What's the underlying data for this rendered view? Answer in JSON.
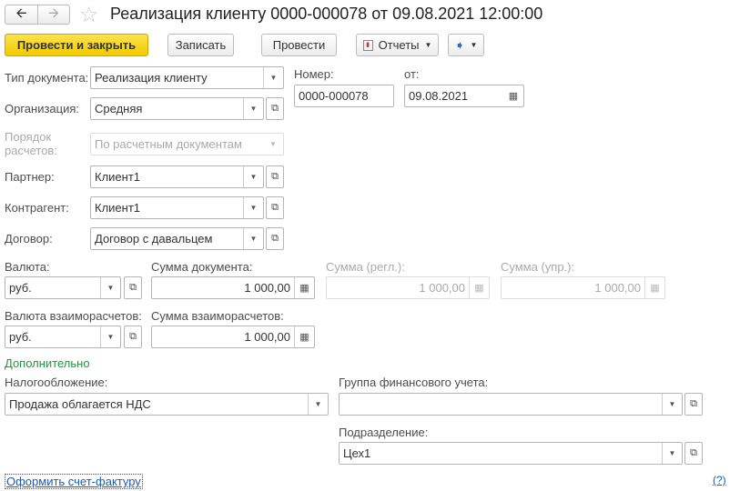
{
  "title": "Реализация клиенту 0000-000078 от 09.08.2021 12:00:00",
  "toolbar": {
    "post_close": "Провести и закрыть",
    "save": "Записать",
    "post": "Провести",
    "reports": "Отчеты"
  },
  "fields": {
    "doc_type": {
      "label": "Тип документа:",
      "value": "Реализация клиенту"
    },
    "number": {
      "label": "Номер:",
      "value": "0000-000078"
    },
    "date": {
      "label": "от:",
      "value": "09.08.2021"
    },
    "org": {
      "label": "Организация:",
      "value": "Средняя"
    },
    "settle": {
      "label": "Порядок расчетов:",
      "value": "По расчетным документам"
    },
    "partner": {
      "label": "Партнер:",
      "value": "Клиент1"
    },
    "counterparty": {
      "label": "Контрагент:",
      "value": "Клиент1"
    },
    "contract": {
      "label": "Договор:",
      "value": "Договор с давальцем"
    },
    "currency": {
      "label": "Валюта:",
      "value": "руб."
    },
    "doc_sum": {
      "label": "Сумма документа:",
      "value": "1 000,00"
    },
    "sum_reg": {
      "label": "Сумма (регл.):",
      "value": "1 000,00"
    },
    "sum_mgmt": {
      "label": "Сумма (упр.):",
      "value": "1 000,00"
    },
    "settle_currency": {
      "label": "Валюта взаиморасчетов:",
      "value": "руб."
    },
    "settle_sum": {
      "label": "Сумма взаиморасчетов:",
      "value": "1 000,00"
    },
    "taxation": {
      "label": "Налогообложение:",
      "value": "Продажа облагается НДС"
    },
    "fin_group": {
      "label": "Группа финансового учета:",
      "value": ""
    },
    "division": {
      "label": "Подразделение:",
      "value": "Цех1"
    }
  },
  "section_additional": "Дополнительно",
  "invoice_link": "Оформить счет-фактуру",
  "help": "(?)"
}
